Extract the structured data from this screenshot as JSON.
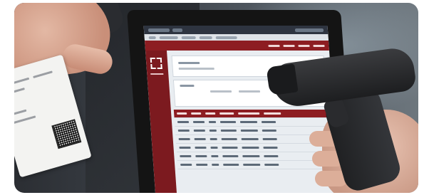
{
  "photo": {
    "subject": "",
    "colors": {
      "app_accent": "#8d1d22",
      "scanner": "#1d1e20",
      "background": "#3a3f46"
    }
  }
}
